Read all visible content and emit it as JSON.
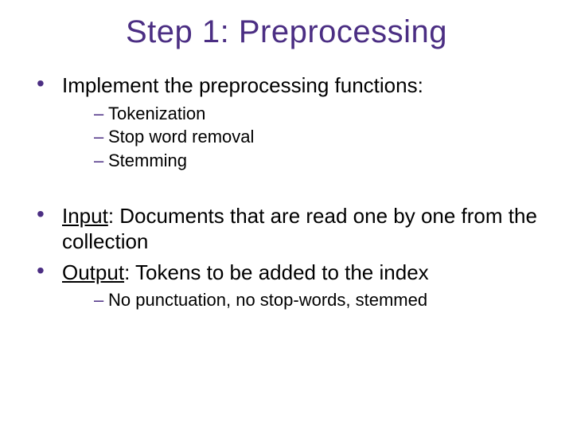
{
  "title": "Step 1: Preprocessing",
  "bullets": {
    "b0": {
      "text": "Implement the preprocessing functions:",
      "sub": [
        "Tokenization",
        "Stop word removal",
        "Stemming"
      ]
    },
    "b1": {
      "label": "Input",
      "rest": ": Documents that are read one by one from the collection"
    },
    "b2": {
      "label": "Output",
      "rest": ": Tokens to be added to the index",
      "sub": [
        "No punctuation, no stop-words, stemmed"
      ]
    }
  }
}
